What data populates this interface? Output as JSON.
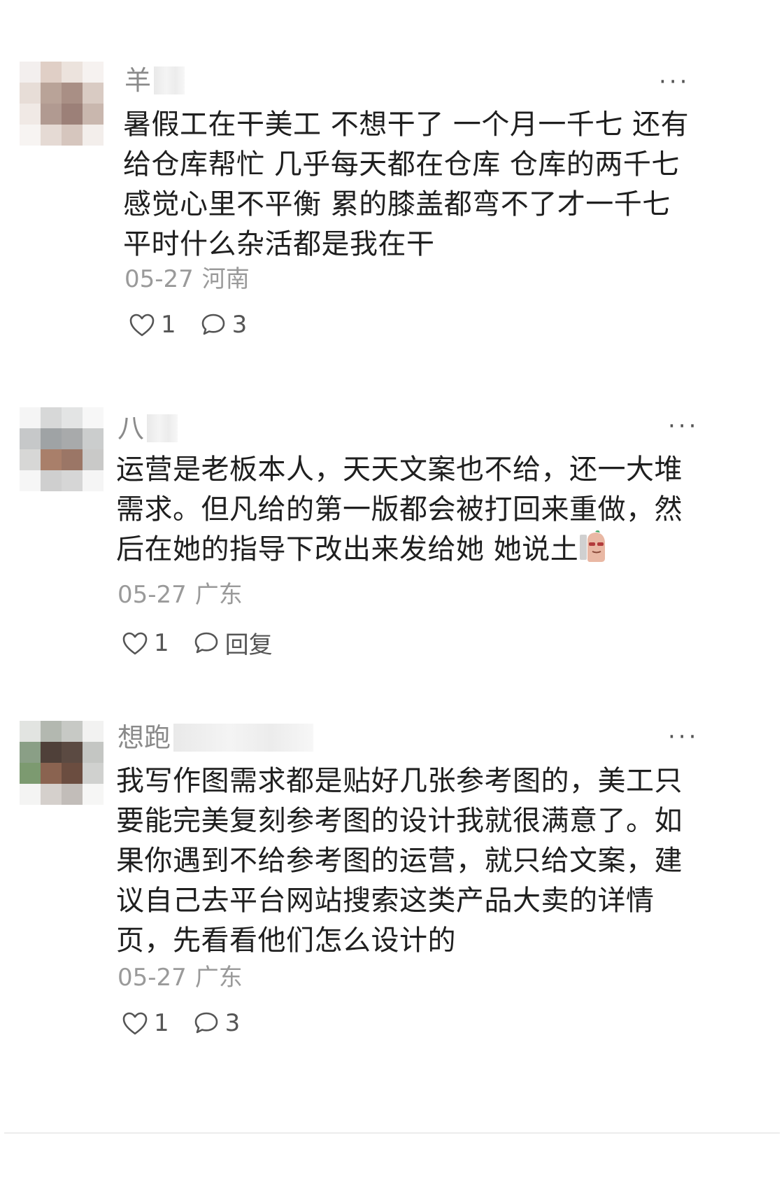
{
  "comments": [
    {
      "username": "羊",
      "text": "暑假工在干美工 不想干了 一个月一千七 还有给仓库帮忙 几乎每天都在仓库 仓库的两千七 感觉心里不平衡 累的膝盖都弯不了才一千七 平时什么杂活都是我在干",
      "date": "05-27",
      "location": "河南",
      "likes": "1",
      "replies": "3",
      "more_label": "···"
    },
    {
      "username": "八",
      "text": "运营是老板本人，天天文案也不给，还一大堆需求。但凡给的第一版都会被打回来重做，然后在她的指导下改出来发给她 她说土",
      "date": "05-27",
      "location": "广东",
      "likes": "1",
      "replies": "回复",
      "more_label": "···"
    },
    {
      "username": "想跑",
      "text": "我写作图需求都是贴好几张参考图的，美工只要能完美复刻参考图的设计我就很满意了。如果你遇到不给参考图的运营，就只给文案，建议自己去平台网站搜索这类产品大卖的详情页，先看看他们怎么设计的",
      "date": "05-27",
      "location": "广东",
      "likes": "1",
      "replies": "3",
      "more_label": "···"
    }
  ],
  "icons": {
    "like": "heart-icon",
    "reply": "comment-bubble-icon",
    "more": "more-dots-icon"
  }
}
